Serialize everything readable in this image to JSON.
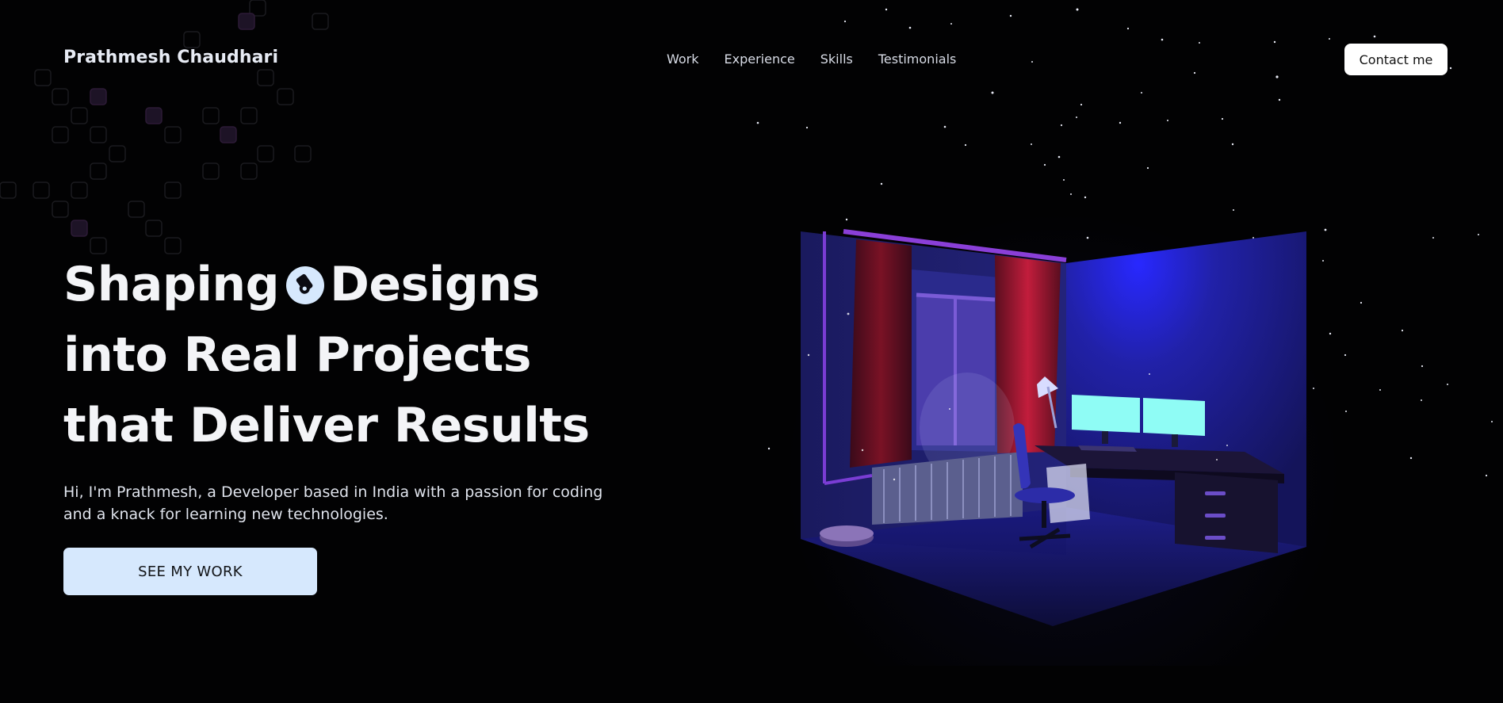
{
  "header": {
    "brand": "Prathmesh Chaudhari",
    "nav": [
      "Work",
      "Experience",
      "Skills",
      "Testimonials"
    ],
    "contact_label": "Contact me"
  },
  "hero": {
    "headline_line1_before": "Shaping",
    "headline_line1_after": "Designs",
    "headline_line2": "into Real Projects",
    "headline_line3": "that Deliver Results",
    "intro": "Hi, I'm Prathmesh, a Developer based in India with a passion for coding and a knack for learning new technologies.",
    "cta_label": "SEE MY WORK"
  },
  "colors": {
    "background": "#020203",
    "cta_bg": "#d6e8fd",
    "room_accent": "#2a2ae0",
    "monitor_glow": "#8ffcf5"
  },
  "icons": [
    "pen-tool-icon"
  ]
}
